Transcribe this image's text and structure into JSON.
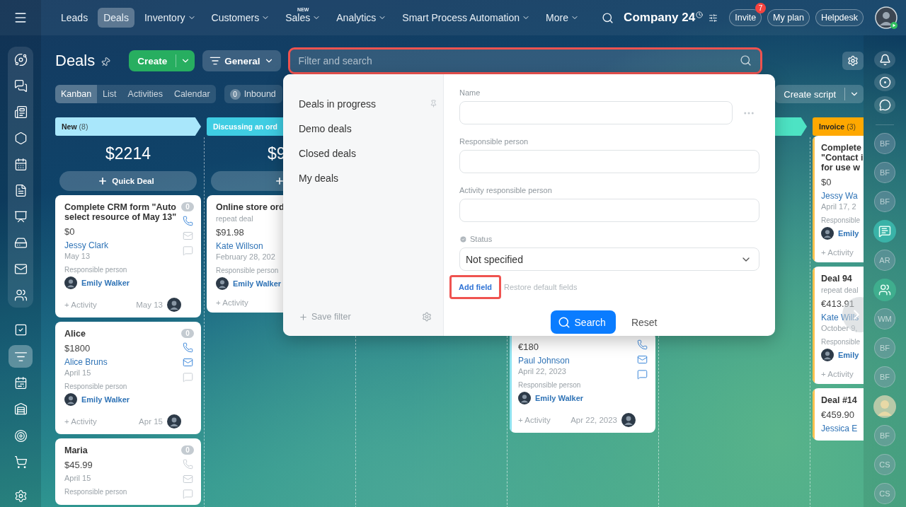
{
  "topbar": {
    "nav": [
      {
        "label": "Leads",
        "selected": false,
        "menu": false
      },
      {
        "label": "Deals",
        "selected": true,
        "menu": false
      },
      {
        "label": "Inventory",
        "selected": false,
        "menu": true
      },
      {
        "label": "Customers",
        "selected": false,
        "menu": true
      },
      {
        "label": "Sales",
        "selected": false,
        "menu": true,
        "badge": "NEW"
      },
      {
        "label": "Analytics",
        "selected": false,
        "menu": true
      },
      {
        "label": "Smart Process Automation",
        "selected": false,
        "menu": true
      },
      {
        "label": "More",
        "selected": false,
        "menu": true
      }
    ],
    "company": "Company 24",
    "buttons": [
      {
        "label": "Invite",
        "count": "7"
      },
      {
        "label": "My plan"
      },
      {
        "label": "Helpdesk"
      }
    ]
  },
  "sidebar": {
    "group": [
      {
        "selected": false
      },
      {
        "selected": false
      },
      {
        "selected": false
      },
      {
        "selected": false
      },
      {
        "selected": false
      },
      {
        "selected": false
      },
      {
        "selected": false
      },
      {
        "selected": false
      },
      {
        "selected": false
      },
      {
        "selected": false
      }
    ],
    "items": [
      {
        "selected": false
      },
      {
        "selected": true
      },
      {
        "selected": false
      },
      {
        "selected": false
      },
      {
        "selected": false
      },
      {
        "selected": false
      }
    ]
  },
  "header": {
    "title": "Deals",
    "create": "Create",
    "category": "General",
    "filter": {
      "placeholder": "Filter and search",
      "highlighted": true
    }
  },
  "views": [
    {
      "label": "Kanban",
      "selected": true
    },
    {
      "label": "List",
      "selected": false
    },
    {
      "label": "Activities",
      "selected": false
    },
    {
      "label": "Calendar",
      "selected": false
    }
  ],
  "inbound": {
    "count": "0",
    "label": "Inbound"
  },
  "create_script": "Create script",
  "columns": [
    {
      "name": "New",
      "count": "(8)",
      "color": "#a9e7fb",
      "covered": false,
      "total": "$2214",
      "quick_deal": true,
      "quick_label": "Quick Deal",
      "cards": [
        {
          "title": "Complete CRM form \"Auto select resource of May 13\"",
          "amount": "$0",
          "contact": "Jessy Clark",
          "date": "May 13",
          "responsible_label": "Responsible person",
          "responsible": "Emily Walker",
          "activity": "+ Activity",
          "due": "May 13",
          "owner_avatar": true,
          "counter": "0",
          "phone": true,
          "mail": false,
          "chat": false
        },
        {
          "title": "Alice",
          "amount": "$1800",
          "contact": "Alice Bruns",
          "date": "April 15",
          "responsible_label": "Responsible person",
          "responsible": "Emily Walker",
          "activity": "+ Activity",
          "due": "Apr 15",
          "owner_avatar": true,
          "counter": "0",
          "phone": true,
          "mail": true,
          "chat": false
        },
        {
          "title": "Maria",
          "amount": "$45.99",
          "date": "April 15",
          "responsible_label": "Responsible person",
          "counter": "0",
          "phone": false,
          "mail": false,
          "chat": false
        }
      ]
    },
    {
      "name": "Discussing an ord",
      "color": "#3fcde3",
      "covered": false,
      "total": "$9",
      "quick_deal": true,
      "cards": [
        {
          "title": "Online store ord",
          "subtitle": "repeat deal",
          "amount": "$91.98",
          "contact": "Kate Willson",
          "date": "February 28, 202",
          "responsible_label": "Responsible person",
          "responsible": "Emily Walker",
          "activity": "+ Activity"
        }
      ]
    },
    {
      "covered": true
    },
    {
      "covered": true,
      "cards": [
        {
          "amount": "€180",
          "contact": "Paul Johnson",
          "date": "April 22, 2023",
          "responsible_label": "Responsible person",
          "responsible": "Emily Walker",
          "activity": "+ Activity",
          "due": "Apr 22, 2023",
          "owner_avatar": true,
          "phone": true,
          "mail": true,
          "chat": true,
          "color": "#8fe3f0"
        }
      ]
    },
    {
      "color": "#4de3c4",
      "covered": false
    },
    {
      "name": "Invoice",
      "count": "(3)",
      "color": "#ffa800",
      "covered": false,
      "cards": [
        {
          "title_lines": [
            "Complete",
            "\"Contact i",
            "for use w"
          ],
          "amount": "$0",
          "contact": "Jessy Wa",
          "date": "April 17, 2",
          "responsible_label": "Responsible",
          "responsible": "Emily",
          "activity": "+ Activity",
          "color": "#ffc24d"
        },
        {
          "title": "Deal 94",
          "subtitle": "repeat deal",
          "amount": "€413.91",
          "contact": "Kate Wills",
          "date": "October 9,",
          "responsible_label": "Responsible",
          "responsible": "Emily",
          "activity": "+ Activity",
          "color": "#ffc24d"
        },
        {
          "title": "Deal #14",
          "amount": "€459.90",
          "contact": "Jessica E",
          "color": "#ffc24d"
        }
      ]
    }
  ],
  "filter_popup": {
    "presets": [
      {
        "label": "Deals in progress",
        "pinned": true
      },
      {
        "label": "Demo deals",
        "pinned": false
      },
      {
        "label": "Closed deals",
        "pinned": false
      },
      {
        "label": "My deals",
        "pinned": false
      }
    ],
    "save_filter": "Save filter",
    "fields": [
      {
        "kind": "text",
        "label": "Name",
        "more": true
      },
      {
        "kind": "text",
        "label": "Responsible person"
      },
      {
        "kind": "text",
        "label": "Activity responsible person"
      },
      {
        "kind": "select",
        "label": "Status",
        "value": "Not specified",
        "required": true
      }
    ],
    "add_field": {
      "label": "Add field",
      "highlighted": true
    },
    "restore": "Restore default fields",
    "search": "Search",
    "reset": "Reset"
  },
  "right_sidebar": [
    {
      "kind": "initials",
      "text": "BF"
    },
    {
      "kind": "initials",
      "text": "BF"
    },
    {
      "kind": "initials",
      "text": "BF"
    },
    {
      "kind": "chat"
    },
    {
      "kind": "initials",
      "text": "AR"
    },
    {
      "kind": "group"
    },
    {
      "kind": "initials",
      "text": "WM"
    },
    {
      "kind": "initials",
      "text": "BF"
    },
    {
      "kind": "initials",
      "text": "BF"
    },
    {
      "kind": "photo"
    },
    {
      "kind": "initials",
      "text": "BF"
    },
    {
      "kind": "initials",
      "text": "CS"
    },
    {
      "kind": "initials",
      "text": "CS"
    }
  ]
}
